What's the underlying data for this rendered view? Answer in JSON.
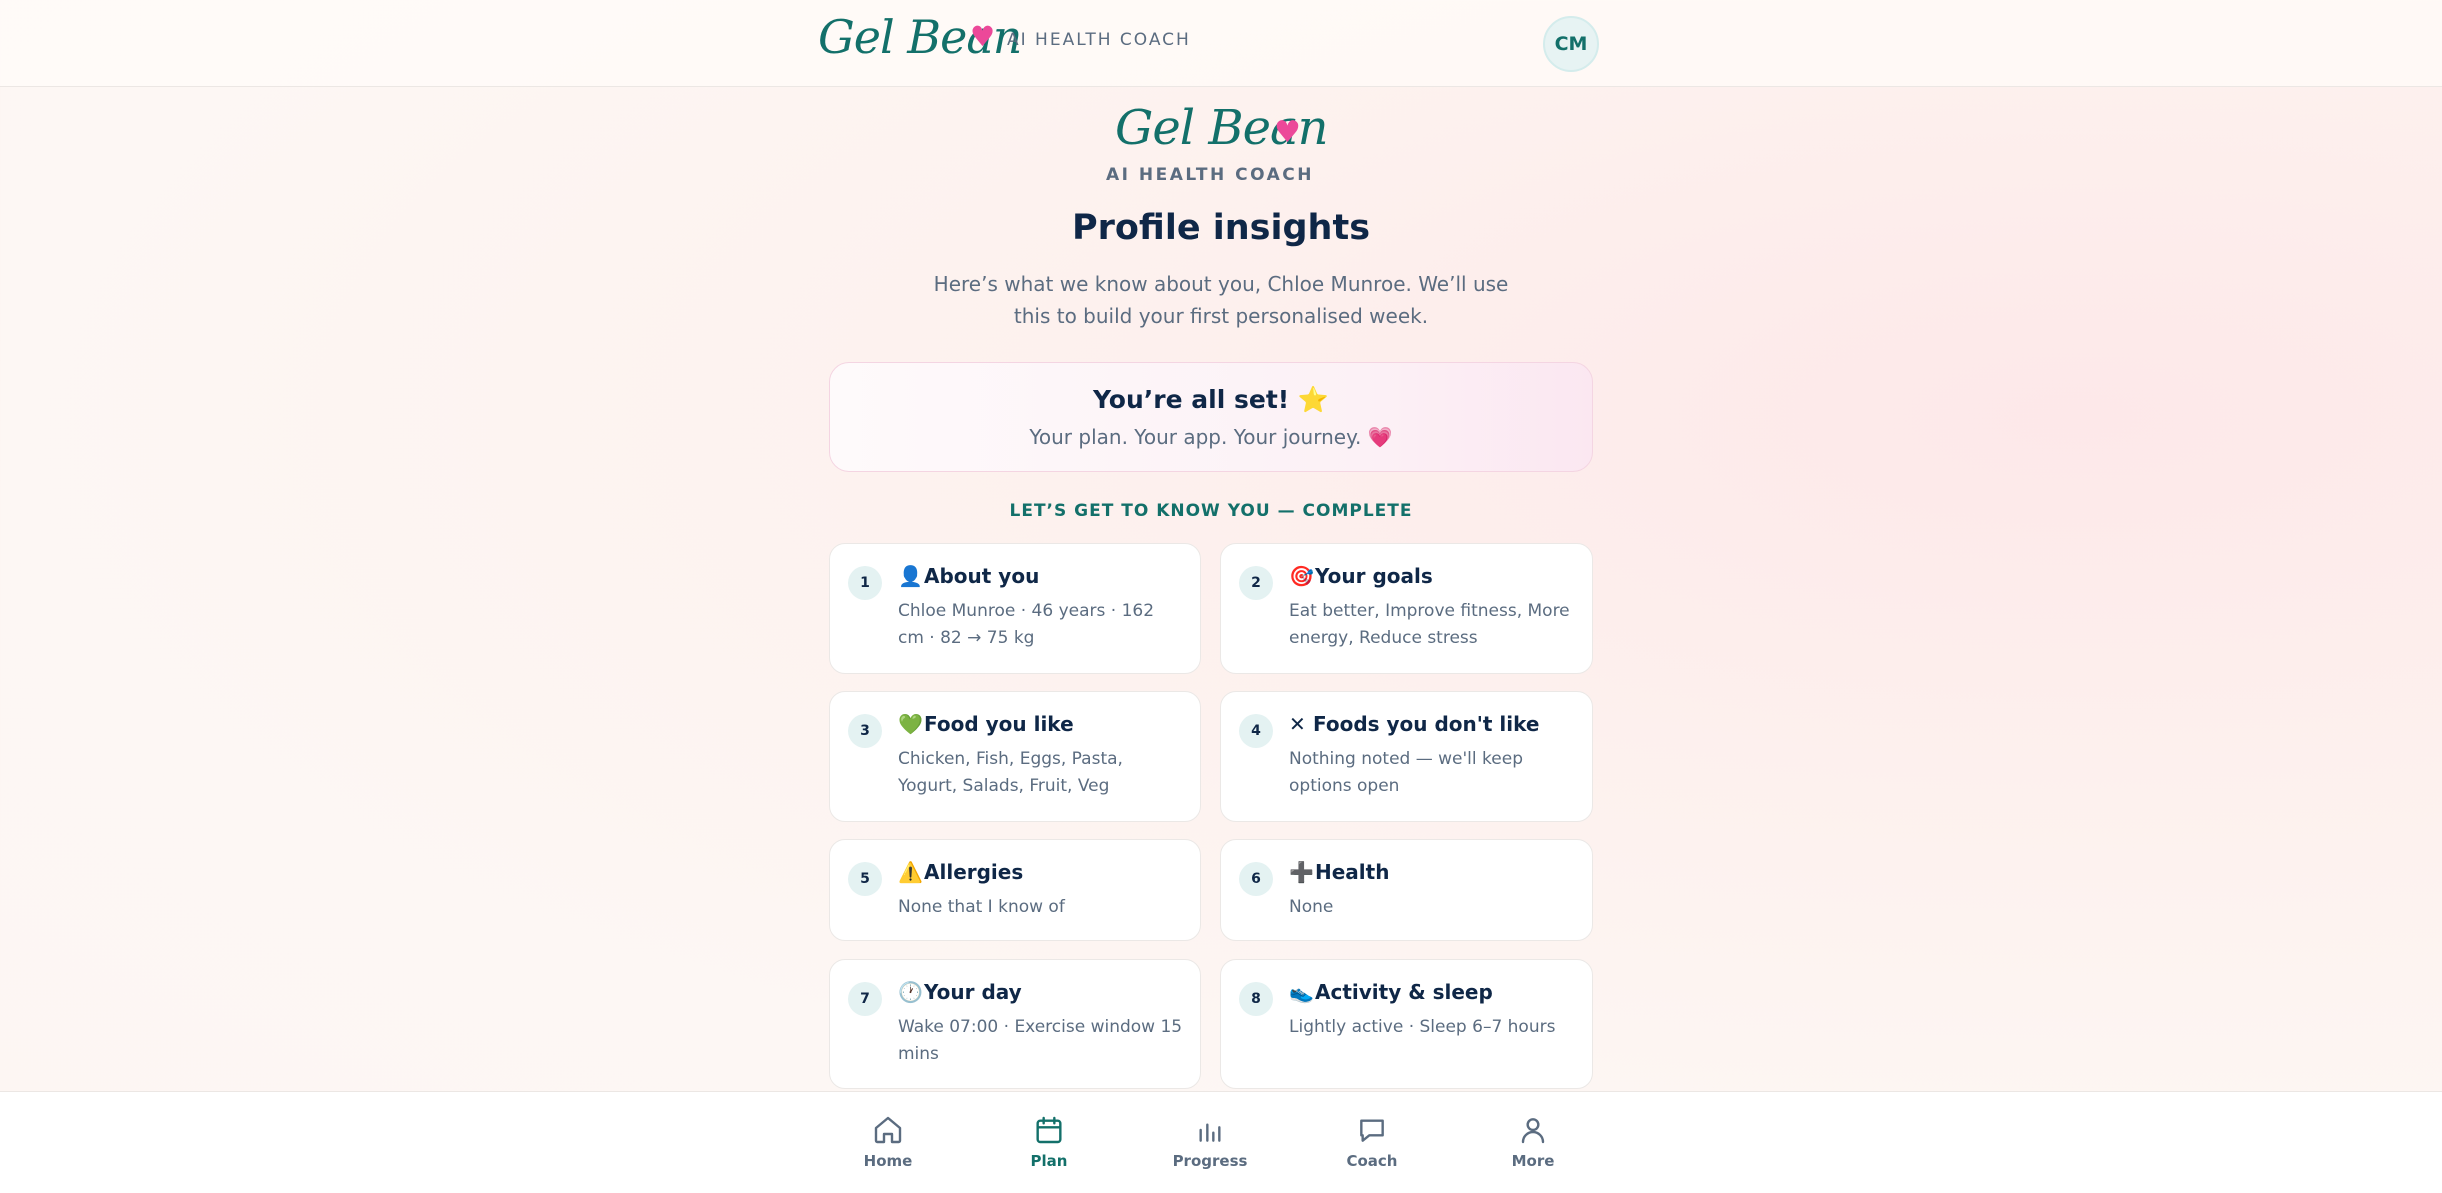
{
  "brand": {
    "name": "Gel Bean",
    "heart": "♥",
    "tagline": "AI HEALTH COACH"
  },
  "user": {
    "initials": "CM"
  },
  "page": {
    "title": "Profile insights",
    "subtitle": "Here’s what we know about you, Chloe Munroe. We’ll use this to build your first personalised week."
  },
  "banner": {
    "title": "You’re all set! ⭐",
    "subtitle": "Your plan. Your app. Your journey. 💗"
  },
  "section_label": "LET’S GET TO KNOW YOU — COMPLETE",
  "cards": [
    {
      "num": "1",
      "icon": "👤",
      "icon_name": "person-icon",
      "title": "About you",
      "text": "Chloe Munroe · 46 years · 162 cm · 82 → 75 kg"
    },
    {
      "num": "2",
      "icon": "🎯",
      "icon_name": "target-icon",
      "title": "Your goals",
      "text": "Eat better, Improve fitness, More energy, Reduce stress"
    },
    {
      "num": "3",
      "icon": "💚",
      "icon_name": "green-heart-icon",
      "title": "Food you like",
      "text": "Chicken, Fish, Eggs, Pasta, Yogurt, Salads, Fruit, Veg"
    },
    {
      "num": "4",
      "icon": "✕",
      "icon_name": "cross-icon",
      "title": "Foods you don't like",
      "text": "Nothing noted — we'll keep options open"
    },
    {
      "num": "5",
      "icon": "⚠️",
      "icon_name": "warning-icon",
      "title": "Allergies",
      "text": "None that I know of"
    },
    {
      "num": "6",
      "icon": "➕",
      "icon_name": "plus-icon",
      "title": "Health",
      "text": "None"
    },
    {
      "num": "7",
      "icon": "🕐",
      "icon_name": "clock-icon",
      "title": "Your day",
      "text": "Wake 07:00 · Exercise window 15 mins"
    },
    {
      "num": "8",
      "icon": "👟",
      "icon_name": "sneaker-icon",
      "title": "Activity & sleep",
      "text": "Lightly active · Sleep 6–7 hours"
    }
  ],
  "nav": {
    "items": [
      {
        "label": "Home",
        "icon": "home-icon"
      },
      {
        "label": "Plan",
        "icon": "calendar-icon",
        "active": true
      },
      {
        "label": "Progress",
        "icon": "bar-chart-icon"
      },
      {
        "label": "Coach",
        "icon": "chat-icon"
      },
      {
        "label": "More",
        "icon": "user-icon"
      }
    ]
  },
  "colors": {
    "accent": "#13706a",
    "heart": "#ec4899",
    "text": "#0f2747",
    "muted": "#5b6c80"
  }
}
